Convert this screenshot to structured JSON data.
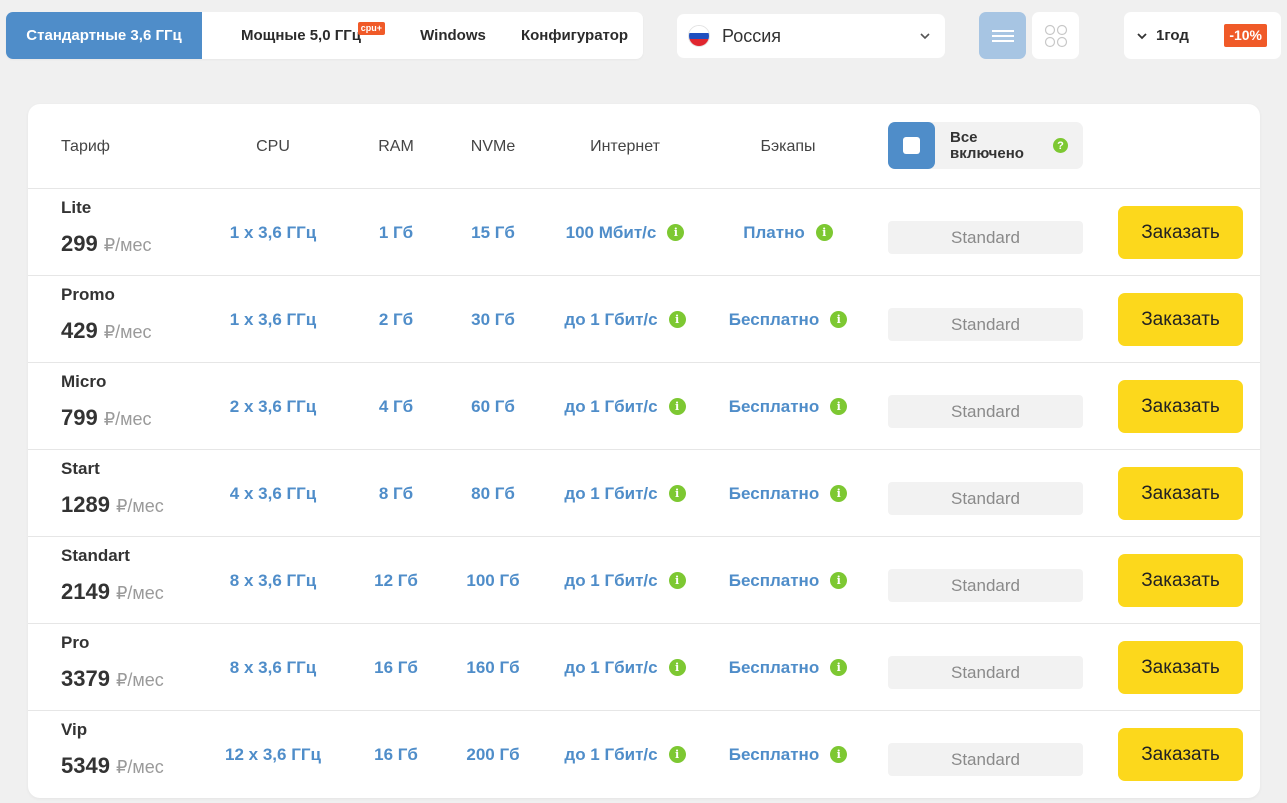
{
  "tabs": [
    {
      "label": "Стандартные 3,6 ГГц"
    },
    {
      "label": "Мощные 5,0 ГГц",
      "badge": "cpu+"
    },
    {
      "label": "Windows"
    },
    {
      "label": "Конфигуратор"
    }
  ],
  "country": {
    "label": "Россия",
    "flag_colors": [
      "#ffffff",
      "#1f4fbf",
      "#e0262f"
    ]
  },
  "view_toggle": {
    "list_icon": "list-icon",
    "grid_icon": "grid-icon"
  },
  "period": {
    "label": "1год",
    "discount": "-10%"
  },
  "colors": {
    "accent": "#4f8dc9",
    "order_button": "#fcd81c",
    "info": "#7dc832",
    "discount": "#f05a28"
  },
  "table": {
    "headers": {
      "tariff": "Тариф",
      "cpu": "CPU",
      "ram": "RAM",
      "nvme": "NVMe",
      "internet": "Интернет",
      "backups": "Бэкапы",
      "all_included": "Все включено",
      "help": "?"
    },
    "price_unit": "₽/мес",
    "info_glyph": "i",
    "rows": [
      {
        "name": "Lite",
        "price": "299",
        "unit": "₽/мес",
        "cpu": "1 x 3,6 ГГц",
        "ram": "1 Гб",
        "nvme": "15 Гб",
        "internet": "100 Мбит/с",
        "backups": "Платно",
        "plan": "Standard",
        "order": "Заказать"
      },
      {
        "name": "Promo",
        "price": "429",
        "unit": "₽/мес",
        "cpu": "1 x 3,6 ГГц",
        "ram": "2 Гб",
        "nvme": "30 Гб",
        "internet": "до 1 Гбит/с",
        "backups": "Бесплатно",
        "plan": "Standard",
        "order": "Заказать"
      },
      {
        "name": "Micro",
        "price": "799",
        "unit": "₽/мес",
        "cpu": "2 x 3,6 ГГц",
        "ram": "4 Гб",
        "nvme": "60 Гб",
        "internet": "до 1 Гбит/с",
        "backups": "Бесплатно",
        "plan": "Standard",
        "order": "Заказать"
      },
      {
        "name": "Start",
        "price": "1289",
        "unit": "₽/мес",
        "cpu": "4 x 3,6 ГГц",
        "ram": "8 Гб",
        "nvme": "80 Гб",
        "internet": "до 1 Гбит/с",
        "backups": "Бесплатно",
        "plan": "Standard",
        "order": "Заказать"
      },
      {
        "name": "Standart",
        "price": "2149",
        "unit": "₽/мес",
        "cpu": "8 x 3,6 ГГц",
        "ram": "12 Гб",
        "nvme": "100 Гб",
        "internet": "до 1 Гбит/с",
        "backups": "Бесплатно",
        "plan": "Standard",
        "order": "Заказать"
      },
      {
        "name": "Pro",
        "price": "3379",
        "unit": "₽/мес",
        "cpu": "8 x 3,6 ГГц",
        "ram": "16 Гб",
        "nvme": "160 Гб",
        "internet": "до 1 Гбит/с",
        "backups": "Бесплатно",
        "plan": "Standard",
        "order": "Заказать"
      },
      {
        "name": "Vip",
        "price": "5349",
        "unit": "₽/мес",
        "cpu": "12 x 3,6 ГГц",
        "ram": "16 Гб",
        "nvme": "200 Гб",
        "internet": "до 1 Гбит/с",
        "backups": "Бесплатно",
        "plan": "Standard",
        "order": "Заказать"
      }
    ]
  }
}
